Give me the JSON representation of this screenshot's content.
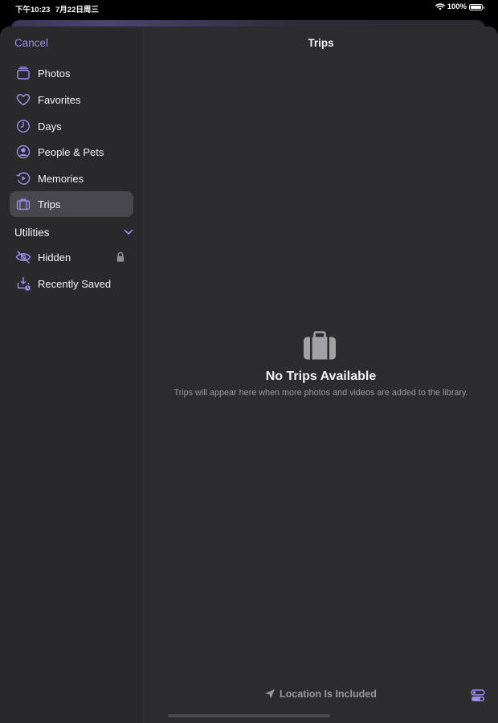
{
  "status_bar": {
    "time": "下午10:23",
    "date": "7月22日周三",
    "battery_percent": "100%"
  },
  "nav": {
    "cancel_label": "Cancel",
    "title": "Trips"
  },
  "sidebar": {
    "items": [
      {
        "label": "Photos",
        "icon": "photos-icon",
        "selected": false
      },
      {
        "label": "Favorites",
        "icon": "heart-icon",
        "selected": false
      },
      {
        "label": "Days",
        "icon": "clock-icon",
        "selected": false
      },
      {
        "label": "People & Pets",
        "icon": "person-circle-icon",
        "selected": false
      },
      {
        "label": "Memories",
        "icon": "memories-icon",
        "selected": false
      },
      {
        "label": "Trips",
        "icon": "suitcase-icon",
        "selected": true
      }
    ],
    "utilities_header": "Utilities",
    "utilities": [
      {
        "label": "Hidden",
        "icon": "eye-slash-icon",
        "locked": true
      },
      {
        "label": "Recently Saved",
        "icon": "tray-download-icon",
        "locked": false
      }
    ]
  },
  "empty_state": {
    "title": "No Trips Available",
    "subtitle": "Trips will appear here when more photos and videos are added to the library."
  },
  "footer": {
    "location_label": "Location Is Included"
  },
  "colors": {
    "accent": "#9e8df0",
    "background": "#2c2c2e",
    "sidebar": "#29292b",
    "selected_row": "#48484c"
  }
}
